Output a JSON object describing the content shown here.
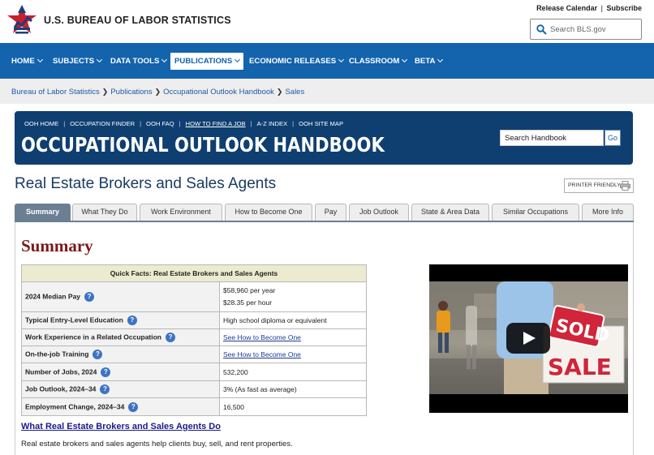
{
  "header": {
    "agency_name": "U.S. BUREAU OF LABOR STATISTICS",
    "release_calendar": "Release Calendar",
    "separator": "|",
    "subscribe": "Subscribe",
    "search_placeholder": "Search BLS.gov"
  },
  "nav": {
    "items": [
      {
        "label": "HOME"
      },
      {
        "label": "SUBJECTS"
      },
      {
        "label": "DATA TOOLS"
      },
      {
        "label": "PUBLICATIONS"
      },
      {
        "label": "ECONOMIC RELEASES"
      },
      {
        "label": "CLASSROOM"
      },
      {
        "label": "BETA"
      }
    ],
    "active": "PUBLICATIONS"
  },
  "breadcrumb": [
    "Bureau of Labor Statistics",
    "Publications",
    "Occupational Outlook Handbook",
    "Sales"
  ],
  "ooh": {
    "links": [
      "OOH HOME",
      "OCCUPATION FINDER",
      "OOH FAQ",
      "HOW TO FIND A JOB",
      "A-Z INDEX",
      "OOH SITE MAP"
    ],
    "title": "OCCUPATIONAL OUTLOOK HANDBOOK",
    "search_placeholder": "Search Handbook",
    "go_label": "Go"
  },
  "page": {
    "title": "Real Estate Brokers and Sales Agents",
    "printer_label": "PRINTER FRIENDLY"
  },
  "tabs": [
    {
      "label": "Summary"
    },
    {
      "label": "What They Do"
    },
    {
      "label": "Work Environment"
    },
    {
      "label": "How to Become One"
    },
    {
      "label": "Pay"
    },
    {
      "label": "Job Outlook"
    },
    {
      "label": "State & Area Data"
    },
    {
      "label": "Similar Occupations"
    },
    {
      "label": "More Info"
    }
  ],
  "summary": {
    "heading": "Summary",
    "quick_facts": {
      "title": "Quick Facts: Real Estate Brokers and Sales Agents",
      "rows": [
        {
          "label": "2024 Median Pay",
          "value": "$58,960 per year",
          "value2": "$28.35 per hour"
        },
        {
          "label": "Typical Entry-Level Education",
          "value": "High school diploma or equivalent"
        },
        {
          "label": "Work Experience in a Related Occupation",
          "value": "See How to Become One"
        },
        {
          "label": "On-the-job Training",
          "value": "See How to Become One"
        },
        {
          "label": "Number of Jobs, 2024",
          "value": "532,200"
        },
        {
          "label": "Job Outlook, 2024–34",
          "value": "3% (As fast as average)"
        },
        {
          "label": "Employment Change, 2024–34",
          "value": "16,500"
        }
      ]
    },
    "video": {
      "sign_sold": "SOLD",
      "sign_sale": "SALE"
    },
    "what_they_do_link": "What Real Estate Brokers and Sales Agents Do",
    "description": "Real estate brokers and sales agents help clients buy, sell, and rent properties."
  },
  "colors": {
    "nav_blue": "#1463ad",
    "banner_navy": "#0f3f70",
    "active_tab": "#6b7f93",
    "summary_heading": "#7a1a1a"
  }
}
